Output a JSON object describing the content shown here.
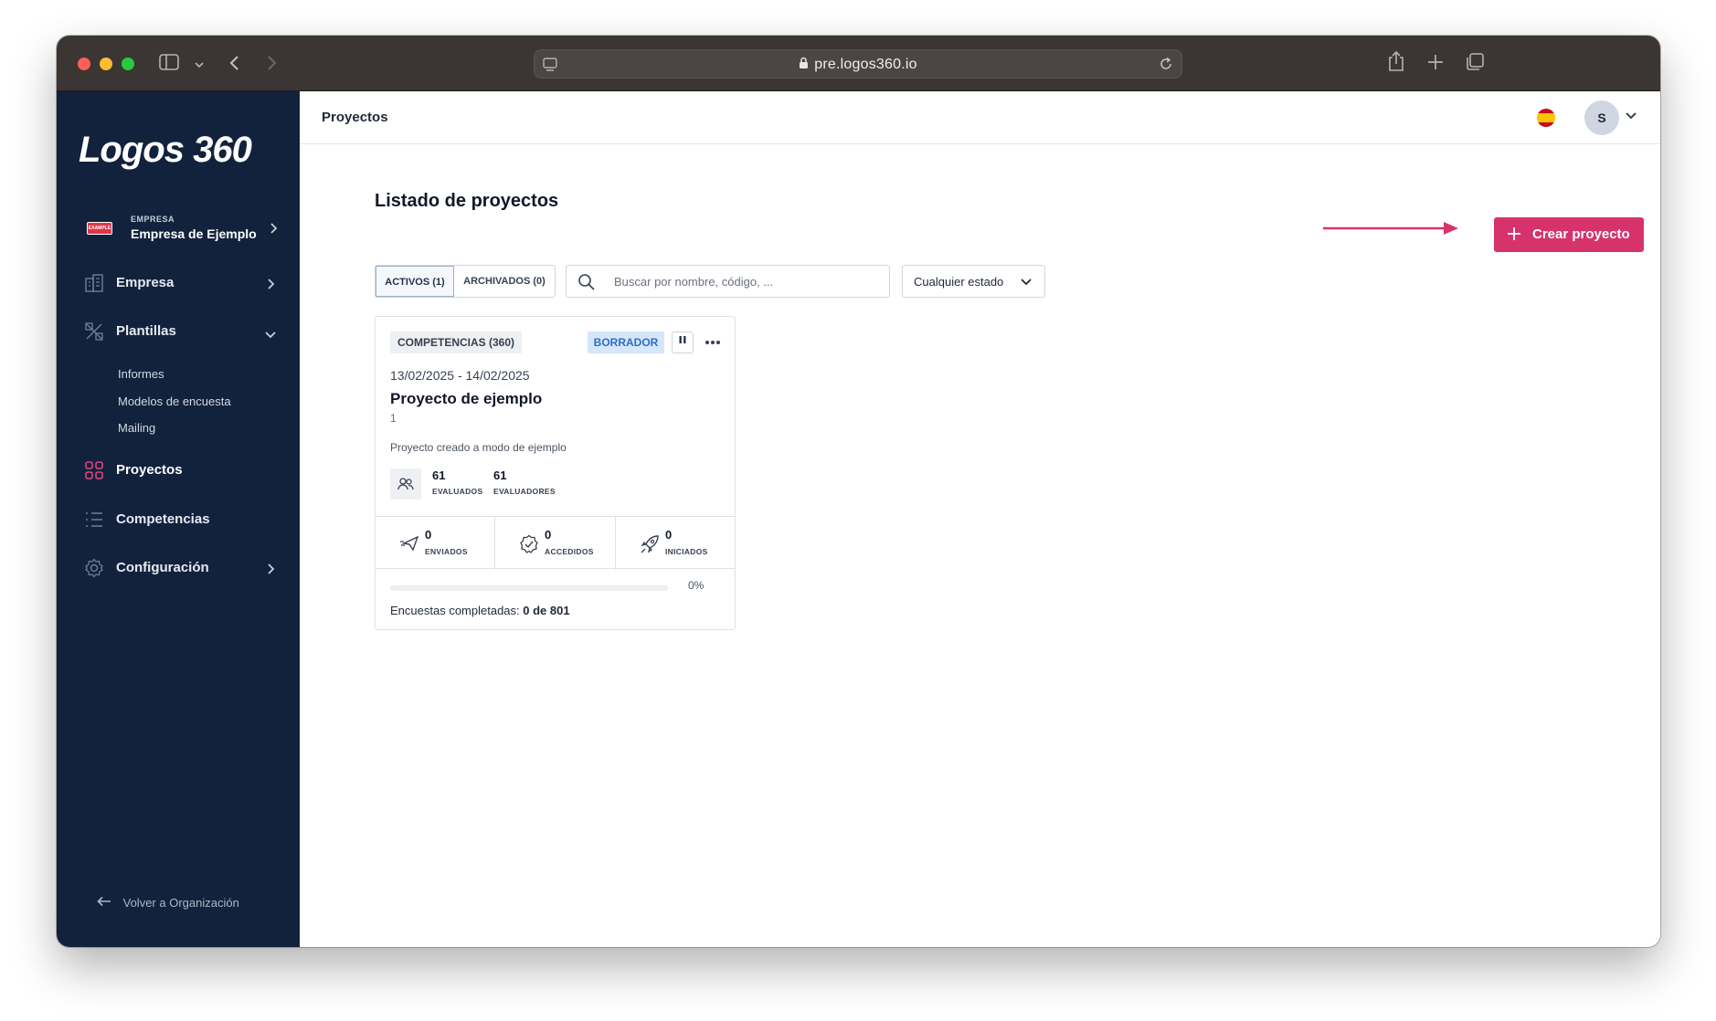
{
  "browser": {
    "url": "pre.logos360.io"
  },
  "sidebar": {
    "logo": "Logos 360",
    "company": {
      "flag_text": "EXAMPLE",
      "caption": "EMPRESA",
      "name": "Empresa de Ejemplo"
    },
    "items": [
      {
        "label": "Empresa",
        "icon": "building-icon",
        "expandable": true
      },
      {
        "label": "Plantillas",
        "icon": "templates-icon",
        "expanded": true
      },
      {
        "label": "Proyectos",
        "icon": "grid-icon",
        "active": true
      },
      {
        "label": "Competencias",
        "icon": "list-icon"
      },
      {
        "label": "Configuración",
        "icon": "gear-icon",
        "expandable": true
      }
    ],
    "subitems": [
      "Informes",
      "Modelos de encuesta",
      "Mailing"
    ],
    "back_label": "Volver a Organización"
  },
  "topbar": {
    "crumb": "Proyectos",
    "avatar_initial": "S"
  },
  "main": {
    "title": "Listado de proyectos",
    "create_label": "Crear proyecto",
    "tabs": [
      "ACTIVOS (1)",
      "ARCHIVADOS (0)"
    ],
    "search_placeholder": "Buscar por nombre, código, ...",
    "state_filter": "Cualquier estado"
  },
  "card": {
    "type": "COMPETENCIAS (360)",
    "status": "BORRADOR",
    "dates": "13/02/2025 - 14/02/2025",
    "title": "Proyecto de ejemplo",
    "code": "1",
    "description": "Proyecto creado a modo de ejemplo",
    "evaluados": {
      "value": "61",
      "label": "EVALUADOS"
    },
    "evaluadores": {
      "value": "61",
      "label": "EVALUADORES"
    },
    "stats": [
      {
        "value": "0",
        "label": "ENVIADOS",
        "icon": "send-icon"
      },
      {
        "value": "0",
        "label": "ACCEDIDOS",
        "icon": "badge-check-icon"
      },
      {
        "value": "0",
        "label": "INICIADOS",
        "icon": "rocket-icon"
      }
    ],
    "progress_percent": 0,
    "progress_label": "0%",
    "completed_label": "Encuestas completadas:",
    "completed_value": "0 de 801"
  },
  "colors": {
    "sidebar_bg": "#12223d",
    "accent": "#d6336c",
    "status_badge_bg": "#d6e6fb",
    "status_badge_text": "#2b6fc7"
  }
}
